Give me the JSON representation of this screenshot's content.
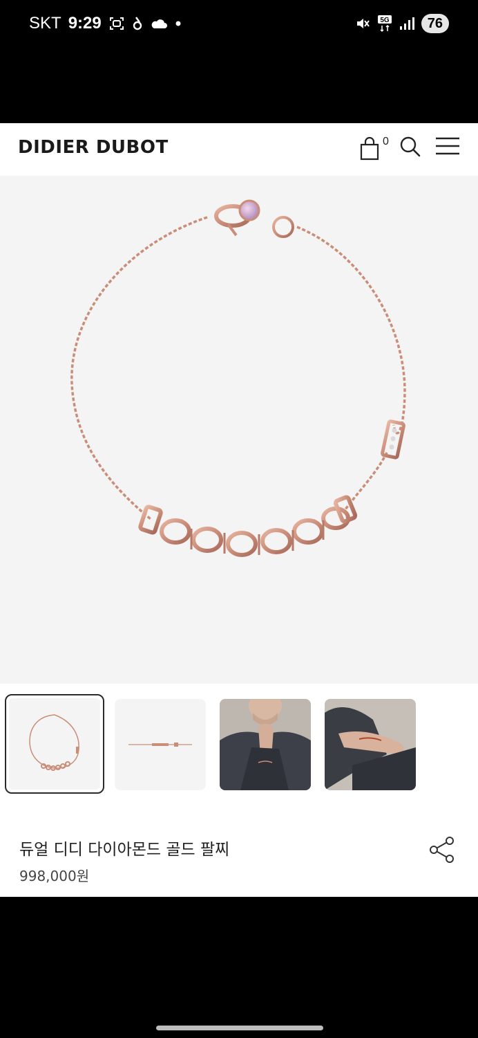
{
  "status_bar": {
    "carrier": "SKT",
    "time": "9:29",
    "network": "5G",
    "battery": "76",
    "left_icons": [
      "screenshot-icon",
      "app-icon",
      "cloud-icon",
      "dot-icon"
    ],
    "right_icons": [
      "mute-icon",
      "5g-icon",
      "signal-icon"
    ]
  },
  "header": {
    "brand": "DIDIER DUBOT",
    "cart_count": "0",
    "icons": [
      "shopping-bag-icon",
      "search-icon",
      "menu-icon"
    ]
  },
  "product": {
    "name": "듀얼 디디 다이아몬드 골드 팔찌",
    "price": "998,000원",
    "thumbnails": [
      "bracelet-front",
      "bracelet-flat",
      "model-wearing-chin",
      "model-wrist"
    ],
    "selected_thumbnail": 0
  },
  "colors": {
    "rose_gold": "#c98d78",
    "hero_bg": "#f5f4f4",
    "header_bg": "#ffffff",
    "text": "#1f1f1f"
  }
}
